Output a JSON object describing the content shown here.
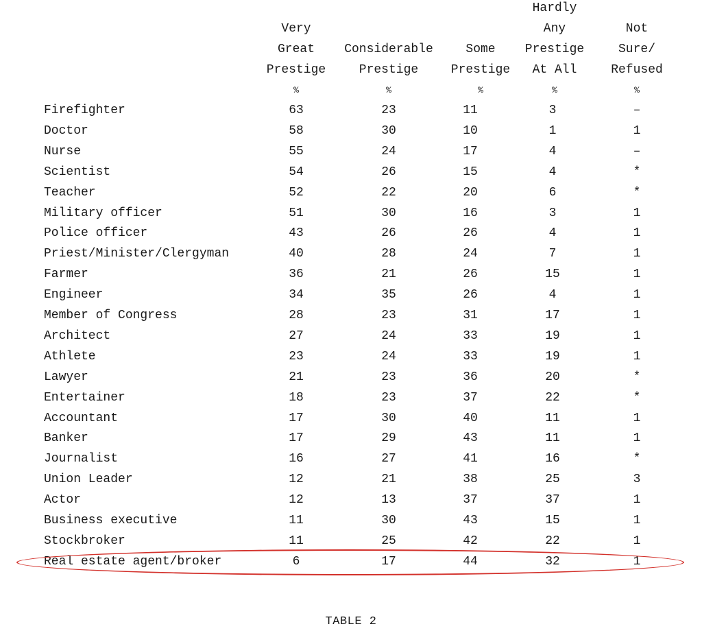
{
  "table": {
    "columns": [
      {
        "lines": [
          "",
          "Very",
          "Great",
          "Prestige"
        ],
        "unit": "%"
      },
      {
        "lines": [
          "",
          "",
          "Considerable",
          "Prestige"
        ],
        "unit": "%"
      },
      {
        "lines": [
          "",
          "",
          "Some",
          "Prestige"
        ],
        "unit": "%"
      },
      {
        "lines": [
          "Hardly",
          "Any",
          "Prestige",
          "At All"
        ],
        "unit": "%"
      },
      {
        "lines": [
          "",
          "Not",
          "Sure/",
          "Refused"
        ],
        "unit": "%"
      }
    ],
    "rows": [
      {
        "label": "Firefighter",
        "values": [
          "63",
          "23",
          "11",
          "3",
          "–"
        ]
      },
      {
        "label": "Doctor",
        "values": [
          "58",
          "30",
          "10",
          "1",
          "1"
        ]
      },
      {
        "label": "Nurse",
        "values": [
          "55",
          "24",
          "17",
          "4",
          "–"
        ]
      },
      {
        "label": "Scientist",
        "values": [
          "54",
          "26",
          "15",
          "4",
          "*"
        ]
      },
      {
        "label": "Teacher",
        "values": [
          "52",
          "22",
          "20",
          "6",
          "*"
        ]
      },
      {
        "label": "Military officer",
        "values": [
          "51",
          "30",
          "16",
          "3",
          "1"
        ]
      },
      {
        "label": "Police officer",
        "values": [
          "43",
          "26",
          "26",
          "4",
          "1"
        ]
      },
      {
        "label": "Priest/Minister/Clergyman",
        "values": [
          "40",
          "28",
          "24",
          "7",
          "1"
        ]
      },
      {
        "label": "Farmer",
        "values": [
          "36",
          "21",
          "26",
          "15",
          "1"
        ]
      },
      {
        "label": "Engineer",
        "values": [
          "34",
          "35",
          "26",
          "4",
          "1"
        ]
      },
      {
        "label": "Member of Congress",
        "values": [
          "28",
          "23",
          "31",
          "17",
          "1"
        ]
      },
      {
        "label": "Architect",
        "values": [
          "27",
          "24",
          "33",
          "19",
          "1"
        ]
      },
      {
        "label": "Athlete",
        "values": [
          "23",
          "24",
          "33",
          "19",
          "1"
        ]
      },
      {
        "label": "Lawyer",
        "values": [
          "21",
          "23",
          "36",
          "20",
          "*"
        ]
      },
      {
        "label": "Entertainer",
        "values": [
          "18",
          "23",
          "37",
          "22",
          "*"
        ]
      },
      {
        "label": "Accountant",
        "values": [
          "17",
          "30",
          "40",
          "11",
          "1"
        ]
      },
      {
        "label": "Banker",
        "values": [
          "17",
          "29",
          "43",
          "11",
          "1"
        ]
      },
      {
        "label": "Journalist",
        "values": [
          "16",
          "27",
          "41",
          "16",
          "*"
        ]
      },
      {
        "label": "Union Leader",
        "values": [
          "12",
          "21",
          "38",
          "25",
          "3"
        ]
      },
      {
        "label": "Actor",
        "values": [
          "12",
          "13",
          "37",
          "37",
          "1"
        ]
      },
      {
        "label": "Business executive",
        "values": [
          "11",
          "30",
          "43",
          "15",
          "1"
        ]
      },
      {
        "label": "Stockbroker",
        "values": [
          "11",
          "25",
          "42",
          "22",
          "1"
        ]
      },
      {
        "label": "Real estate agent/broker",
        "values": [
          "6",
          "17",
          "44",
          "32",
          "1"
        ],
        "highlighted": true
      }
    ],
    "highlight_color": "#d3312b"
  },
  "caption": "TABLE 2"
}
